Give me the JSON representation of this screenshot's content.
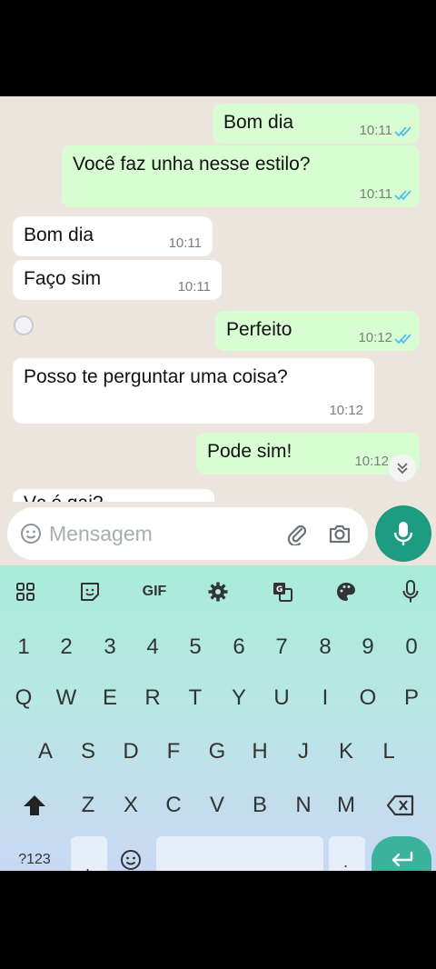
{
  "messages": [
    {
      "dir": "out",
      "text": "Bom dia",
      "time": "10:11"
    },
    {
      "dir": "out",
      "text": "Você faz unha nesse estilo?",
      "time": "10:11"
    },
    {
      "dir": "in",
      "text": "Bom dia",
      "time": "10:11"
    },
    {
      "dir": "in",
      "text": "Faço sim",
      "time": "10:11"
    },
    {
      "dir": "out",
      "text": "Perfeito",
      "time": "10:12"
    },
    {
      "dir": "in",
      "text": "Posso te perguntar uma coisa?",
      "time": "10:12"
    },
    {
      "dir": "out",
      "text": "Pode sim!",
      "time": "10:12"
    },
    {
      "dir": "in",
      "text": "Vc é gai?",
      "time": ""
    }
  ],
  "input": {
    "placeholder": "Mensagem"
  },
  "keyboard": {
    "toolbar": [
      "apps-grid-icon",
      "sticker-icon",
      "GIF",
      "settings-icon",
      "translate-icon",
      "palette-icon",
      "voice-icon"
    ],
    "gif_label": "GIF",
    "numbers": [
      "1",
      "2",
      "3",
      "4",
      "5",
      "6",
      "7",
      "8",
      "9",
      "0"
    ],
    "row1": [
      "Q",
      "W",
      "E",
      "R",
      "T",
      "Y",
      "U",
      "I",
      "O",
      "P"
    ],
    "row2": [
      "A",
      "S",
      "D",
      "F",
      "G",
      "H",
      "J",
      "K",
      "L"
    ],
    "row3": [
      "Z",
      "X",
      "C",
      "V",
      "B",
      "N",
      "M"
    ],
    "symbols_label": "?123",
    "comma": ",",
    "period": "."
  },
  "colors": {
    "outgoing_bubble": "#d9fdd3",
    "incoming_bubble": "#ffffff",
    "chat_background": "#ece5dd",
    "read_ticks": "#53bdeb",
    "accent": "#1e9c82"
  }
}
